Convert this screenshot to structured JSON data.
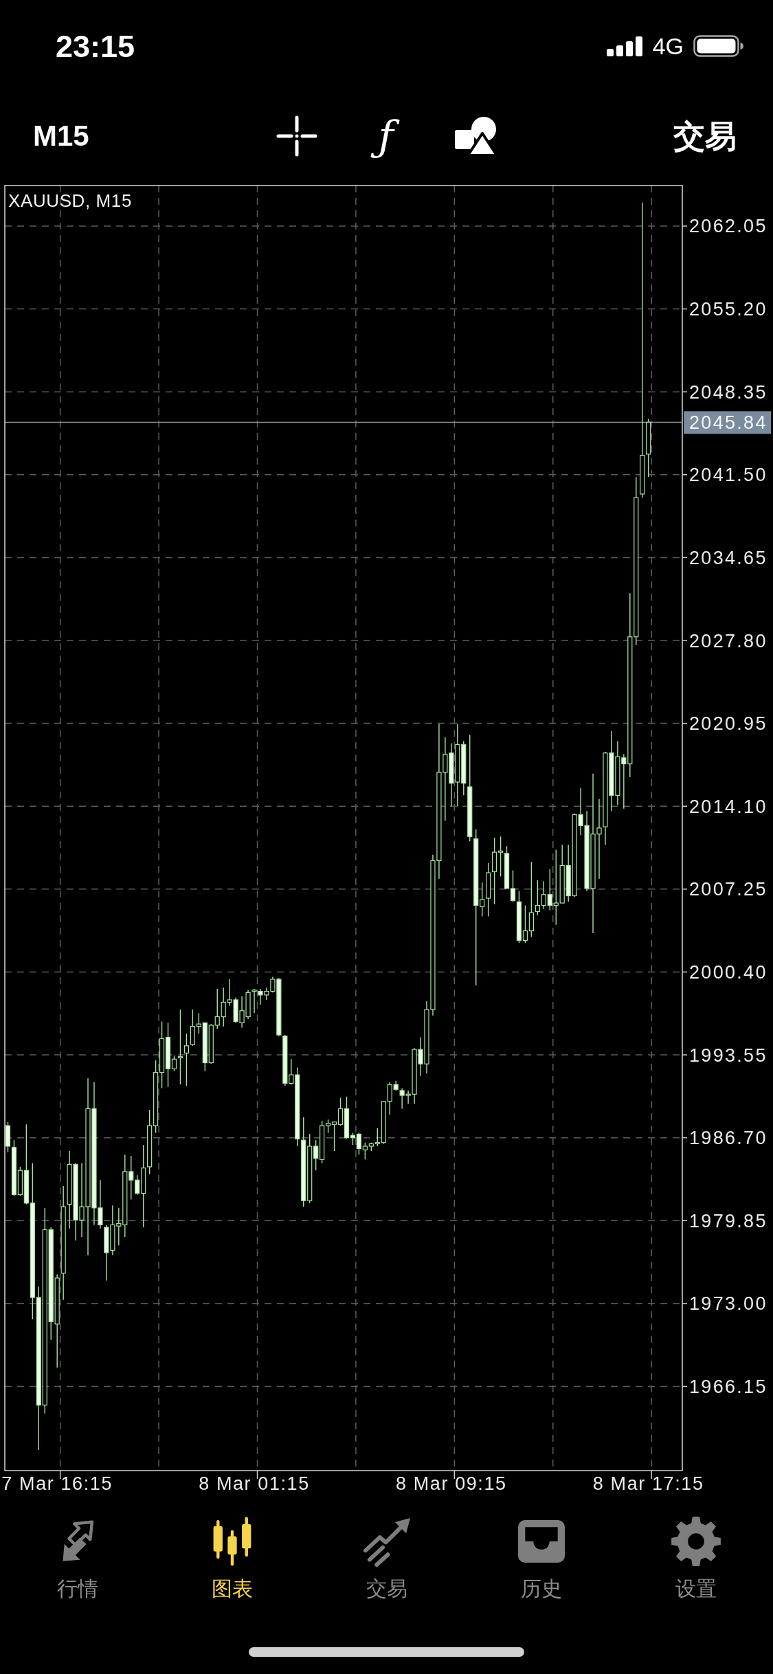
{
  "status_bar": {
    "time": "23:15",
    "network": "4G"
  },
  "toolbar": {
    "timeframe": "M15",
    "function_symbol": "ƒ",
    "trade": "交易"
  },
  "chart": {
    "chart_data": {
      "type": "candlestick",
      "title": "XAUUSD, M15",
      "grid": true,
      "categories": [
        null,
        null,
        null,
        null,
        null,
        null,
        null,
        null,
        "7 Mar 16:15",
        null,
        null,
        null,
        null,
        null,
        null,
        null,
        null,
        null,
        null,
        null,
        null,
        null,
        null,
        null,
        null,
        null,
        null,
        null,
        null,
        null,
        null,
        null,
        null,
        null,
        null,
        null,
        null,
        null,
        null,
        null,
        "8 Mar 01:15",
        null,
        null,
        null,
        null,
        null,
        null,
        null,
        null,
        null,
        null,
        null,
        null,
        null,
        null,
        null,
        null,
        null,
        null,
        null,
        null,
        null,
        null,
        null,
        null,
        null,
        null,
        null,
        null,
        null,
        null,
        null,
        "8 Mar 09:15",
        null,
        null,
        null,
        null,
        null,
        null,
        null,
        null,
        null,
        null,
        null,
        null,
        null,
        null,
        null,
        null,
        null,
        null,
        null,
        null,
        null,
        null,
        null,
        null,
        null,
        null,
        null,
        null,
        null,
        null,
        null,
        "8 Mar 17:15",
        null,
        null,
        null,
        null,
        null
      ],
      "ohlc": [
        [
          1987.7,
          1988.0,
          1985.5,
          1986.0
        ],
        [
          1985.9,
          1986.5,
          1981.9,
          1982.0
        ],
        [
          1982.0,
          1984.3,
          1981.9,
          1984.0
        ],
        [
          1984.0,
          1987.8,
          1981.2,
          1981.3
        ],
        [
          1981.3,
          1984.6,
          1971.7,
          1973.5
        ],
        [
          1973.5,
          1974.4,
          1960.9,
          1964.6
        ],
        [
          1964.6,
          1980.9,
          1963.9,
          1979.1
        ],
        [
          1979.1,
          1979.3,
          1970.0,
          1971.5
        ],
        [
          1971.3,
          1975.4,
          1967.7,
          1975.1
        ],
        [
          1975.5,
          1982.7,
          1973.3,
          1981.0
        ],
        [
          1981.2,
          1985.6,
          1979.2,
          1984.5
        ],
        [
          1984.5,
          1984.6,
          1978.2,
          1979.9
        ],
        [
          1979.9,
          1984.6,
          1978.5,
          1981.0
        ],
        [
          1981.0,
          1991.6,
          1977.0,
          1989.1
        ],
        [
          1989.1,
          1991.3,
          1979.5,
          1980.9
        ],
        [
          1980.9,
          1983.2,
          1979.2,
          1979.5
        ],
        [
          1979.3,
          1979.5,
          1974.9,
          1977.2
        ],
        [
          1977.4,
          1981.1,
          1977.0,
          1979.5
        ],
        [
          1979.4,
          1980.9,
          1977.8,
          1979.6
        ],
        [
          1979.5,
          1985.3,
          1978.5,
          1983.9
        ],
        [
          1983.9,
          1985.2,
          1981.6,
          1983.2
        ],
        [
          1983.2,
          1983.6,
          1982.0,
          1982.1
        ],
        [
          1982.1,
          1986.1,
          1979.3,
          1984.2
        ],
        [
          1984.3,
          1989.0,
          1983.7,
          1987.7
        ],
        [
          1987.7,
          1993.1,
          1987.1,
          1992.1
        ],
        [
          1992.1,
          1996.3,
          1990.8,
          1994.9
        ],
        [
          1995.0,
          1996.2,
          1990.9,
          1992.4
        ],
        [
          1992.4,
          1993.5,
          1992.2,
          1993.2
        ],
        [
          1993.3,
          1997.3,
          1991.1,
          1993.4
        ],
        [
          1993.7,
          1995.3,
          1991.0,
          1994.3
        ],
        [
          1994.4,
          1997.3,
          1994.3,
          1995.9
        ],
        [
          1995.9,
          1997.0,
          1995.3,
          1996.1
        ],
        [
          1996.2,
          1996.2,
          1992.2,
          1992.9
        ],
        [
          1992.9,
          1996.1,
          1992.8,
          1996.0
        ],
        [
          1996.0,
          1999.0,
          1995.7,
          1996.7
        ],
        [
          1996.7,
          1999.1,
          1995.9,
          1997.9
        ],
        [
          1997.9,
          1999.8,
          1997.6,
          1998.1
        ],
        [
          1998.1,
          1998.3,
          1996.2,
          1996.3
        ],
        [
          1996.2,
          1998.4,
          1995.8,
          1997.2
        ],
        [
          1996.7,
          1998.9,
          1996.5,
          1998.7
        ],
        [
          1998.8,
          1999.0,
          1997.0,
          1998.9
        ],
        [
          1998.8,
          1999.0,
          1997.7,
          1998.5
        ],
        [
          1998.5,
          1999.1,
          1998.1,
          1998.8
        ],
        [
          1998.8,
          2000.0,
          1998.7,
          1999.8
        ],
        [
          1999.8,
          1999.9,
          1995.1,
          1995.2
        ],
        [
          1995.1,
          1995.2,
          1991.0,
          1991.2
        ],
        [
          1991.2,
          1993.2,
          1991.1,
          1991.9
        ],
        [
          1991.9,
          1992.5,
          1986.0,
          1986.6
        ],
        [
          1986.5,
          1988.4,
          1981.0,
          1981.5
        ],
        [
          1981.5,
          1987.0,
          1981.3,
          1986.0
        ],
        [
          1986.0,
          1986.5,
          1984.0,
          1985.0
        ],
        [
          1984.9,
          1988.1,
          1984.6,
          1987.7
        ],
        [
          1987.7,
          1988.2,
          1987.1,
          1987.9
        ],
        [
          1987.8,
          1988.0,
          1985.6,
          1988.0
        ],
        [
          1987.8,
          1990.0,
          1987.7,
          1989.1
        ],
        [
          1989.1,
          1990.1,
          1986.6,
          1986.7
        ],
        [
          1986.9,
          1987.1,
          1986.1,
          1986.7
        ],
        [
          1987.0,
          1987.1,
          1985.3,
          1985.8
        ],
        [
          1985.7,
          1986.3,
          1984.9,
          1986.0
        ],
        [
          1986.0,
          1986.3,
          1985.6,
          1986.2
        ],
        [
          1986.2,
          1987.5,
          1986.0,
          1986.3
        ],
        [
          1986.3,
          1989.7,
          1986.2,
          1989.7
        ],
        [
          1989.7,
          1991.3,
          1988.6,
          1991.1
        ],
        [
          1991.1,
          1991.4,
          1990.6,
          1990.7
        ],
        [
          1990.6,
          1990.8,
          1989.1,
          1990.2
        ],
        [
          1990.2,
          1990.6,
          1989.5,
          1990.3
        ],
        [
          1990.3,
          1994.1,
          1989.5,
          1994.0
        ],
        [
          1994.0,
          1995.0,
          1991.8,
          1992.8
        ],
        [
          1992.8,
          1998.0,
          1992.0,
          1997.3
        ],
        [
          1997.3,
          2010.1,
          1996.8,
          2009.6
        ],
        [
          2009.6,
          2020.9,
          2008.1,
          2016.9
        ],
        [
          2016.9,
          2019.8,
          2012.9,
          2018.4
        ],
        [
          2018.5,
          2019.3,
          2014.1,
          2016.0
        ],
        [
          2016.1,
          2020.9,
          2014.1,
          2019.2
        ],
        [
          2019.2,
          2019.5,
          2015.0,
          2016.0
        ],
        [
          2015.7,
          2020.0,
          2011.2,
          2011.6
        ],
        [
          2011.4,
          2012.2,
          1999.3,
          2005.9
        ],
        [
          2005.8,
          2007.8,
          2005.0,
          2006.4
        ],
        [
          2006.5,
          2009.4,
          2005.0,
          2008.6
        ],
        [
          2008.7,
          2011.5,
          2006.0,
          2010.3
        ],
        [
          2010.3,
          2011.6,
          2008.3,
          2010.4
        ],
        [
          2010.2,
          2010.8,
          2007.3,
          2007.3
        ],
        [
          2007.3,
          2008.8,
          2006.2,
          2006.3
        ],
        [
          2006.2,
          2007.1,
          2002.8,
          2003.0
        ],
        [
          2003.0,
          2005.9,
          2002.8,
          2003.8
        ],
        [
          2003.8,
          2009.5,
          2003.3,
          2005.3
        ],
        [
          2005.4,
          2008.0,
          2005.1,
          2005.9
        ],
        [
          2005.9,
          2007.9,
          2005.6,
          2006.8
        ],
        [
          2006.8,
          2008.9,
          2005.5,
          2005.9
        ],
        [
          2005.9,
          2010.5,
          2004.3,
          2006.1
        ],
        [
          2006.1,
          2010.9,
          2006.1,
          2009.2
        ],
        [
          2009.2,
          2010.9,
          2006.2,
          2006.7
        ],
        [
          2006.7,
          2013.5,
          2006.6,
          2013.4
        ],
        [
          2013.4,
          2015.6,
          2011.7,
          2012.5
        ],
        [
          2012.5,
          2013.7,
          2007.1,
          2007.3
        ],
        [
          2007.3,
          2016.8,
          2003.6,
          2011.8
        ],
        [
          2011.8,
          2014.7,
          2008.1,
          2012.3
        ],
        [
          2012.4,
          2018.6,
          2010.9,
          2018.5
        ],
        [
          2018.5,
          2020.3,
          2013.7,
          2015.0
        ],
        [
          2015.0,
          2019.5,
          2014.2,
          2018.2
        ],
        [
          2018.1,
          2018.4,
          2013.9,
          2017.6
        ],
        [
          2017.6,
          2031.7,
          2016.5,
          2028.1
        ],
        [
          2028.1,
          2041.3,
          2027.4,
          2039.6
        ],
        [
          2039.9,
          2064.0,
          2039.6,
          2043.1
        ],
        [
          2043.2,
          2046.1,
          2041.3,
          2045.84
        ],
        null,
        null,
        null,
        null,
        null
      ],
      "ylim": [
        1959.19,
        2065.4
      ],
      "yticks": [
        {
          "value": 2062.05,
          "label": "2062.05"
        },
        {
          "value": 2055.2,
          "label": "2055.20"
        },
        {
          "value": 2048.35,
          "label": "2048.35"
        },
        {
          "value": 2041.5,
          "label": "2041.50"
        },
        {
          "value": 2034.65,
          "label": "2034.65"
        },
        {
          "value": 2027.8,
          "label": "2027.80"
        },
        {
          "value": 2020.95,
          "label": "2020.95"
        },
        {
          "value": 2014.1,
          "label": "2014.10"
        },
        {
          "value": 2007.25,
          "label": "2007.25"
        },
        {
          "value": 2000.4,
          "label": "2000.40"
        },
        {
          "value": 1993.55,
          "label": "1993.55"
        },
        {
          "value": 1986.7,
          "label": "1986.70"
        },
        {
          "value": 1979.85,
          "label": "1979.85"
        },
        {
          "value": 1973.0,
          "label": "1973.00"
        },
        {
          "value": 1966.15,
          "label": "1966.15"
        }
      ],
      "ref_lines": [
        {
          "axis": "y",
          "value": 2045.84,
          "label": "2045.84"
        }
      ]
    }
  },
  "tabs": [
    {
      "label": "行情",
      "kind": "quotes",
      "selected": false
    },
    {
      "label": "图表",
      "kind": "chart",
      "selected": true
    },
    {
      "label": "交易",
      "kind": "trade",
      "selected": false
    },
    {
      "label": "历史",
      "kind": "history",
      "selected": false
    },
    {
      "label": "设置",
      "kind": "settings",
      "selected": false
    }
  ]
}
